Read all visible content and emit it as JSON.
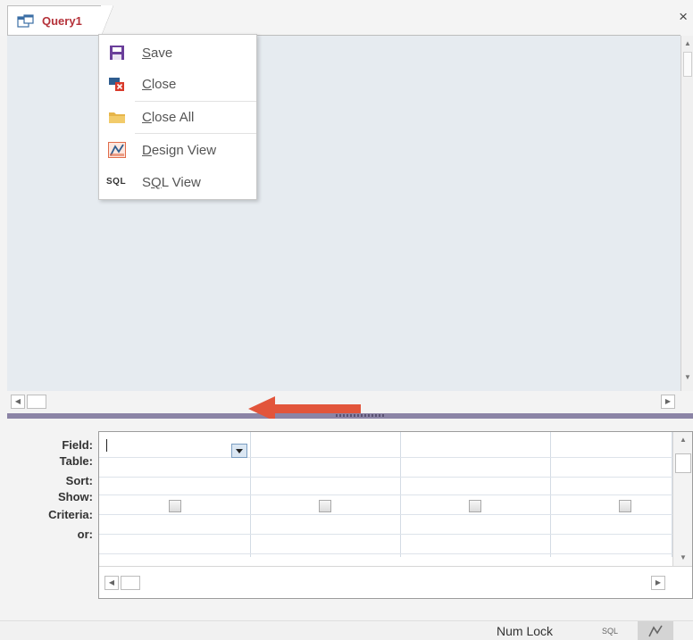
{
  "tab": {
    "label": "Query1",
    "close": "×"
  },
  "context_menu": {
    "items": [
      {
        "key": "S",
        "rest": "ave",
        "icon": "save-icon"
      },
      {
        "key": "C",
        "rest": "lose",
        "icon": "close-object-icon"
      },
      {
        "key": "C",
        "rest": "lose All",
        "icon": "folder-icon"
      },
      {
        "key": "D",
        "rest": "esign View",
        "icon": "design-view-icon"
      },
      {
        "pre": "S",
        "key": "Q",
        "rest": "L View",
        "icon": "sql-icon",
        "icon_text": "SQL"
      }
    ]
  },
  "grid": {
    "row_labels": [
      "Field:",
      "Table:",
      "Sort:",
      "Show:",
      "Criteria:",
      "or:"
    ],
    "columns": 4
  },
  "status_bar": {
    "num_lock": "Num Lock",
    "sql": "SQL"
  },
  "colors": {
    "tab_text": "#b5323a",
    "splitter": "#8b84a6",
    "arrow": "#e2553b",
    "design_area": "#e6ebf0"
  }
}
